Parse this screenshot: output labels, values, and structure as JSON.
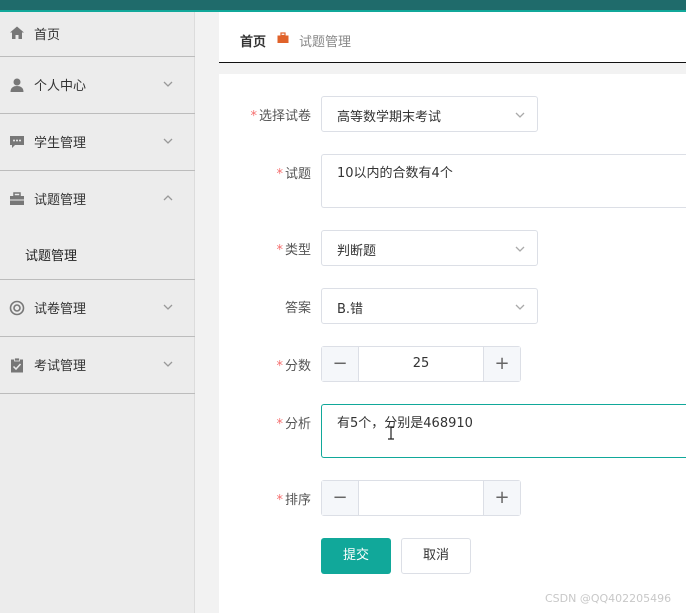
{
  "sidebar": {
    "items": [
      {
        "label": "首页",
        "icon": "home-icon"
      },
      {
        "label": "个人中心",
        "icon": "person-icon"
      },
      {
        "label": "学生管理",
        "icon": "chat-icon"
      },
      {
        "label": "试题管理",
        "icon": "briefcase-icon"
      },
      {
        "label": "试卷管理",
        "icon": "lifebuoy-icon"
      },
      {
        "label": "考试管理",
        "icon": "clipboard-icon"
      }
    ],
    "sub_item": "试题管理"
  },
  "breadcrumb": {
    "home": "首页",
    "current": "试题管理"
  },
  "form": {
    "paper": {
      "label": "选择试卷",
      "value": "高等数学期末考试"
    },
    "question": {
      "label": "试题",
      "value": "10以内的合数有4个"
    },
    "type": {
      "label": "类型",
      "value": "判断题"
    },
    "answer": {
      "label": "答案",
      "value": "B.错"
    },
    "score": {
      "label": "分数",
      "value": "25"
    },
    "analysis": {
      "label": "分析",
      "value": "有5个，分别是468910"
    },
    "order": {
      "label": "排序",
      "value": ""
    }
  },
  "buttons": {
    "submit": "提交",
    "cancel": "取消"
  },
  "watermark": "CSDN @QQ402205496",
  "colors": {
    "accent": "#11a89a",
    "required": "#f56c6c",
    "topbar": "#1f6b6b"
  }
}
